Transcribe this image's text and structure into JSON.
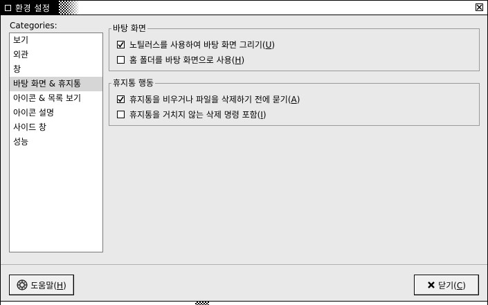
{
  "window": {
    "title": "환경 설정"
  },
  "categories": {
    "label": "Categories:",
    "selected_index": 3,
    "items": [
      {
        "label": "보기"
      },
      {
        "label": "외관"
      },
      {
        "label": "창"
      },
      {
        "label": "바탕 화면 & 휴지통"
      },
      {
        "label": "아이콘 & 목록 보기"
      },
      {
        "label": "아이콘 설명"
      },
      {
        "label": "사이드 창"
      },
      {
        "label": "성능"
      }
    ]
  },
  "desktop_group": {
    "title": "바탕 화면",
    "options": [
      {
        "label_pre": "노틸러스를 사용하여 바탕 화면 그리기(",
        "mnemonic": "U",
        "label_post": ")",
        "checked": true
      },
      {
        "label_pre": "홈 폴더를 바탕 화면으로 사용(",
        "mnemonic": "H",
        "label_post": ")",
        "checked": false
      }
    ]
  },
  "trash_group": {
    "title": "휴지통 행동",
    "options": [
      {
        "label_pre": "휴지통을 비우거나 파일을 삭제하기 전에 묻기(",
        "mnemonic": "A",
        "label_post": ")",
        "checked": true
      },
      {
        "label_pre": "휴지통을 거치지 않는 삭제 명령 포함(",
        "mnemonic": "I",
        "label_post": ")",
        "checked": false
      }
    ]
  },
  "buttons": {
    "help": {
      "label_pre": "도움말(",
      "mnemonic": "H",
      "label_post": ")",
      "icon": "lifebuoy-icon"
    },
    "close": {
      "label_pre": "닫기(",
      "mnemonic": "C",
      "label_post": ")",
      "icon": "x-icon"
    }
  }
}
